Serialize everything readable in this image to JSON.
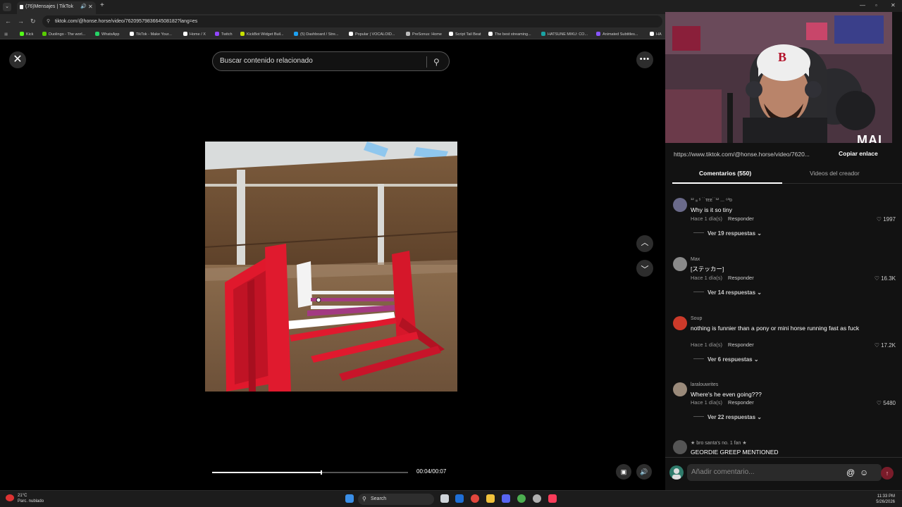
{
  "browser": {
    "tab_title": "(76)Mensajes | TikTok",
    "tab_menu_icon": "chevron-down-icon",
    "new_tab_icon": "plus-icon",
    "url": "tiktok.com/@honse.horse/video/7620957983664508182?lang=es",
    "bookmarks": [
      "Kick",
      "Duolingo - The worl...",
      "WhatsApp",
      "TikTok - Make Your...",
      "Home / X",
      "Twitch",
      "KickBot Widget Buil...",
      "(5) Dashboard / Stre...",
      "Popular | VOCALOID...",
      "PreSonus: Home",
      "Script Tail Beat",
      "The best streaming...",
      "HATSUNE MIKU: CO...",
      "Animated Subtitles...",
      "HA"
    ],
    "bookmark_colors": [
      "#53fc18",
      "#58cc02",
      "#25d366",
      "#ffffff",
      "#ffffff",
      "#9146ff",
      "#c7e000",
      "#1da1f2",
      "#ffffff",
      "#bbbbbb",
      "#ffffff",
      "#ffffff",
      "#1aa3a3",
      "#8855ff",
      "#ffffff"
    ]
  },
  "video": {
    "search_placeholder": "Buscar contenido relacionado",
    "time": "00:04/00:07",
    "progress": 0.52,
    "close_icon": "close-icon",
    "more_icon": "more-horizontal-icon",
    "up_icon": "chevron-up-icon",
    "down_icon": "chevron-down-icon",
    "volume_icon": "volume-icon"
  },
  "panel": {
    "streamer_tag": "MAI",
    "link_url": "https://www.tiktok.com/@honse.horse/video/7620...",
    "copy_label": "Copiar enlace",
    "tab_comments": "Comentarios (550)",
    "tab_creator": "Videos del creador",
    "comment_placeholder": "Añadir comentario...",
    "reply_label": "Responder",
    "comments": [
      {
        "user": "¹² ᵢᵢᵢ ˢ ˙˙ᴛᴇᴇ˙˙¹² ... ⁶³ᴅ",
        "text": "Why is it so tiny",
        "time": "Hace 1 día(s)",
        "likes": "1997",
        "replies": "Ver 19 respuestas"
      },
      {
        "user": "Max",
        "text": "[ステッカー]",
        "time": "Hace 1 día(s)",
        "likes": "16.3K",
        "replies": "Ver 14 respuestas"
      },
      {
        "user": "Soup",
        "text": "nothing is funnier than a pony or mini horse running fast as fuck",
        "time": "Hace 1 día(s)",
        "likes": "17.2K",
        "replies": "Ver 6 respuestas"
      },
      {
        "user": "laralouwrites",
        "text": "Where's he even going???",
        "time": "Hace 1 día(s)",
        "likes": "5480",
        "replies": "Ver 22 respuestas"
      },
      {
        "user": "★ bro santa's no. 1 fan ★",
        "text": "GEORDIE GREEP MENTIONED",
        "time": "",
        "likes": "",
        "replies": ""
      }
    ]
  },
  "taskbar": {
    "temp": "21°C",
    "weather": "Parc. nublado",
    "search": "Search",
    "time": "11:33 PM",
    "date": "5/26/2026"
  }
}
